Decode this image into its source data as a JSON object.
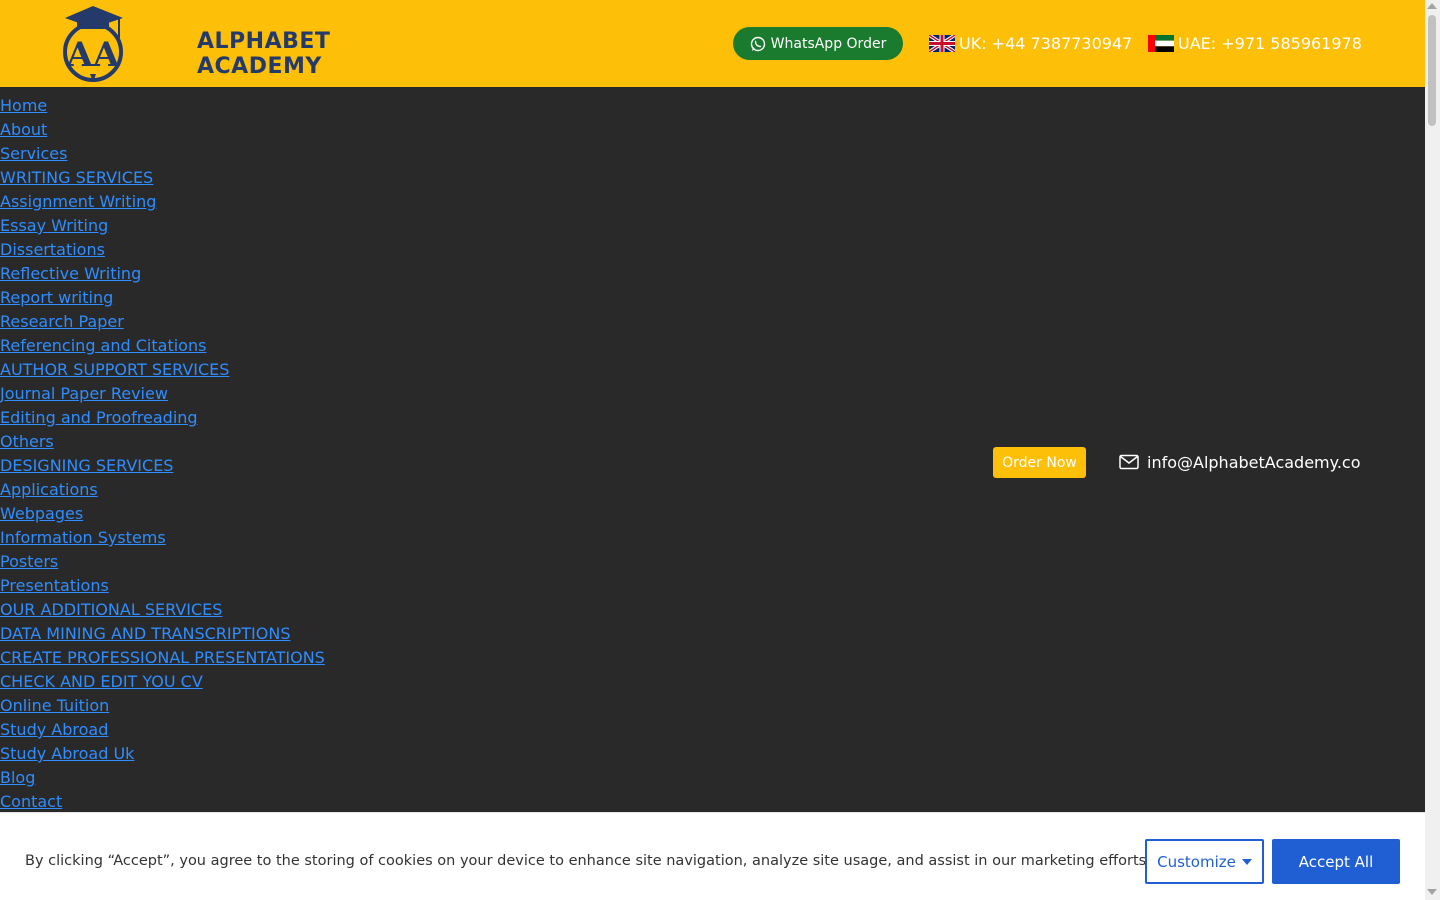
{
  "brand": {
    "line1": "ALPHABET",
    "line2": "ACADEMY",
    "logo_letters": "AA"
  },
  "header": {
    "whatsapp_label": "WhatsApp Order",
    "uk_phone": "UK: +44 7387730947",
    "uae_phone": "UAE: +971 585961978"
  },
  "nav": {
    "home": "Home",
    "about": "About",
    "services": "Services",
    "writing": "WRITING SERVICES",
    "writing_items": [
      "Assignment Writing",
      "Essay Writing",
      "Dissertations",
      "Reflective Writing",
      "Report writing",
      "Research Paper",
      "Referencing and Citations"
    ],
    "author": "AUTHOR SUPPORT SERVICES",
    "author_items": [
      "Journal Paper Review",
      "Editing and Proofreading",
      "Others"
    ],
    "designing": "DESIGNING SERVICES",
    "designing_items": [
      "Applications",
      "Webpages",
      "Information Systems",
      "Posters",
      "Presentations"
    ],
    "additional": "OUR ADDITIONAL SERVICES",
    "additional_items": [
      "DATA MINING AND TRANSCRIPTIONS",
      "CREATE PROFESSIONAL PRESENTATIONS",
      "CHECK AND EDIT YOU CV",
      "Online Tuition"
    ],
    "study_abroad": "Study Abroad",
    "study_abroad_uk": "Study Abroad Uk",
    "blog": "Blog",
    "contact": "Contact"
  },
  "cta": {
    "order_now": "Order Now",
    "email": "info@AlphabetAcademy.co"
  },
  "cookie": {
    "text": "By clicking “Accept”, you agree to the storing of cookies on your device to enhance site navigation, analyze site usage, and assist in our marketing efforts.",
    "customize": "Customize",
    "accept": "Accept All"
  },
  "colors": {
    "header_bg": "#fdbf08",
    "page_bg": "#292929",
    "link": "#2f8dff",
    "whatsapp_bg": "#1a7a2e",
    "primary_button": "#1f5fd3"
  }
}
